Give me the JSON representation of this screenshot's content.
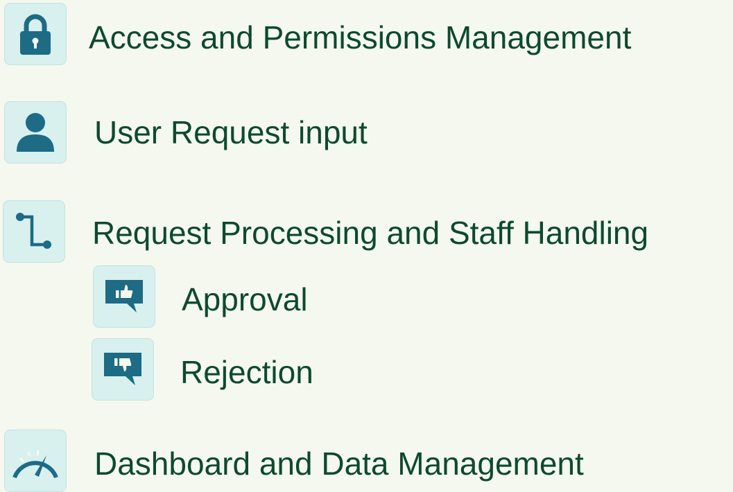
{
  "colors": {
    "background": "#f5f8ef",
    "icon_tile": "#d8f0ee",
    "icon_glyph": "#1d6b85",
    "text": "#0d4a2c"
  },
  "items": [
    {
      "label": "Access and Permissions Management",
      "icon": "lock-icon"
    },
    {
      "label": "User Request input",
      "icon": "user-icon"
    },
    {
      "label": "Request Processing and Staff Handling",
      "icon": "flow-icon",
      "children": [
        {
          "label": "Approval",
          "icon": "thumbs-up-icon"
        },
        {
          "label": "Rejection",
          "icon": "thumbs-down-icon"
        }
      ]
    },
    {
      "label": "Dashboard and Data Management",
      "icon": "gauge-icon"
    }
  ]
}
